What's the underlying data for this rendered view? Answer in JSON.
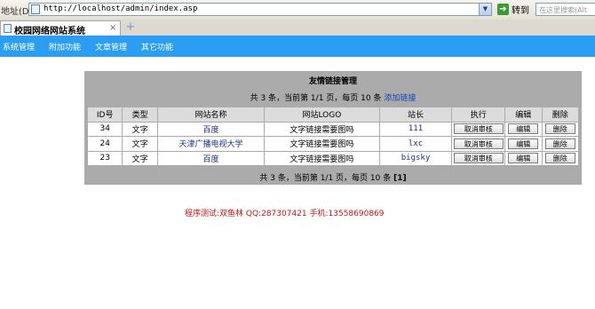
{
  "browser": {
    "address_label": "地址(D)",
    "url": "http://localhost/admin/index.asp",
    "go_label": "转到",
    "search_placeholder": "在这里搜索(Alt",
    "tab_title": "校园网络网站系统",
    "tab_close": "×",
    "new_tab": "+"
  },
  "nav": {
    "items": [
      "系统管理",
      "附加功能",
      "文章管理",
      "其它功能"
    ]
  },
  "panel": {
    "title": "友情链接管理",
    "info_prefix": "共 3 条，当前第 1/1 页，每页 10 条",
    "add_link": "添加链接",
    "columns": [
      "ID号",
      "类型",
      "网站名称",
      "网站LOGO",
      "站长",
      "执行",
      "编辑",
      "删除"
    ],
    "rows": [
      {
        "id": "34",
        "type": "文字",
        "name": "百度",
        "logo": "文字链接需要图吗",
        "owner": "111",
        "action": "取消审核",
        "edit": "编辑",
        "delete": "删除"
      },
      {
        "id": "24",
        "type": "文字",
        "name": "天津广播电视大学",
        "logo": "文字链接需要图吗",
        "owner": "lxc",
        "action": "取消审核",
        "edit": "编辑",
        "delete": "删除"
      },
      {
        "id": "23",
        "type": "文字",
        "name": "百度",
        "logo": "文字链接需要图吗",
        "owner": "bigsky",
        "action": "取消审核",
        "edit": "编辑",
        "delete": "删除"
      }
    ],
    "footer_prefix": "共 3 条，当前第 1/1 页，每页 10 条",
    "footer_page": "[1]"
  },
  "credit": "程序测试:双鱼林 QQ:287307421 手机:13558690869",
  "colors": {
    "nav_bar": "#2b9df2",
    "panel_bg": "#ababab",
    "header_cell": "#dcdcdc",
    "link_blue": "#1a44bb",
    "credit_red": "#cc1111"
  }
}
